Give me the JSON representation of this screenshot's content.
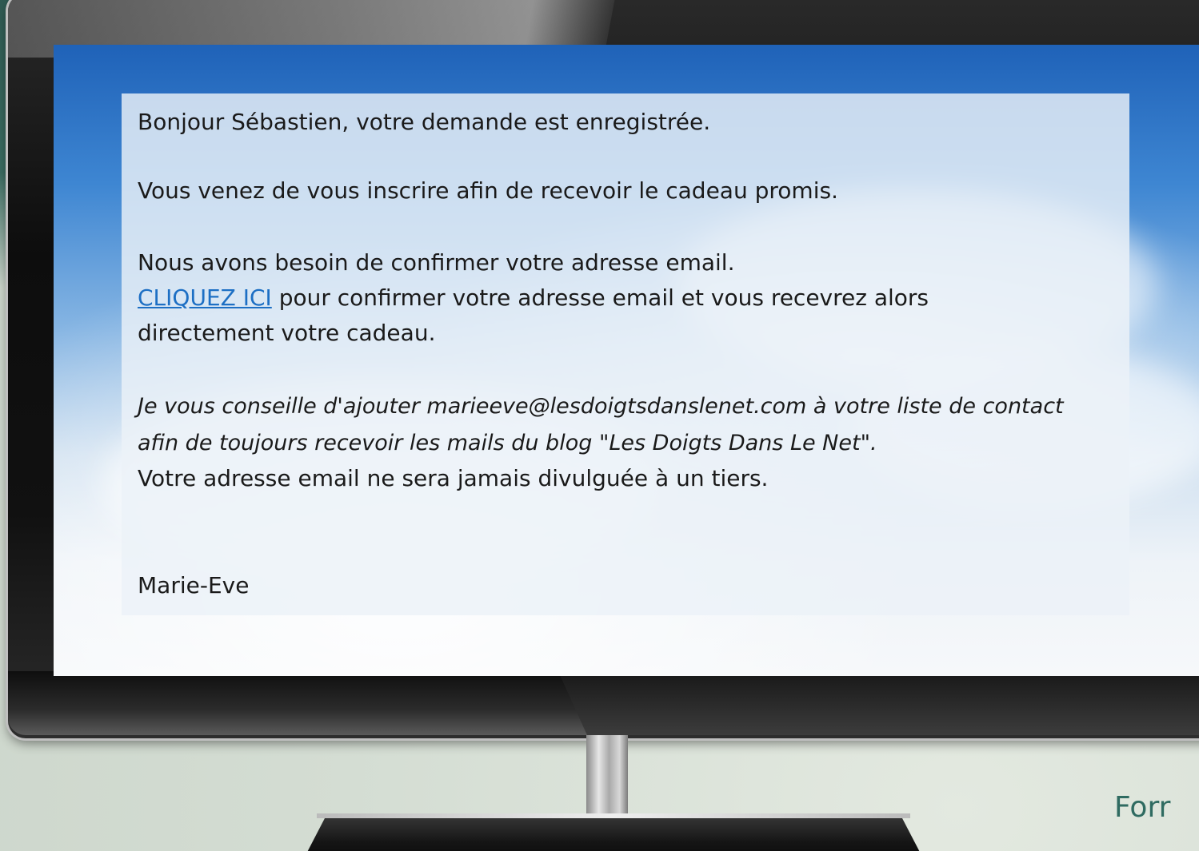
{
  "message": {
    "greeting": "Bonjour Sébastien, votre demande est enregistrée.",
    "subscribed": "Vous venez de vous inscrire afin de recevoir le cadeau promis.",
    "need_confirm": "Nous avons besoin de confirmer votre adresse email.",
    "confirm_link": "CLIQUEZ ICI",
    "confirm_rest": "pour confirmer votre adresse email et vous recevrez alors",
    "confirm_rest_2": "directement votre cadeau.",
    "advice_line_1": "Je vous conseille d'ajouter marieeve@lesdoigtsdanslenet.com à votre liste de contact",
    "advice_line_2": "afin de toujours recevoir les mails du blog \"Les Doigts Dans Le Net\".",
    "privacy": "Votre adresse email ne sera jamais divulguée à un tiers.",
    "signature": "Marie-Eve"
  },
  "corner_label": "Forr",
  "colors": {
    "link": "#1d6fc4",
    "corner_text": "#2f6b61"
  }
}
